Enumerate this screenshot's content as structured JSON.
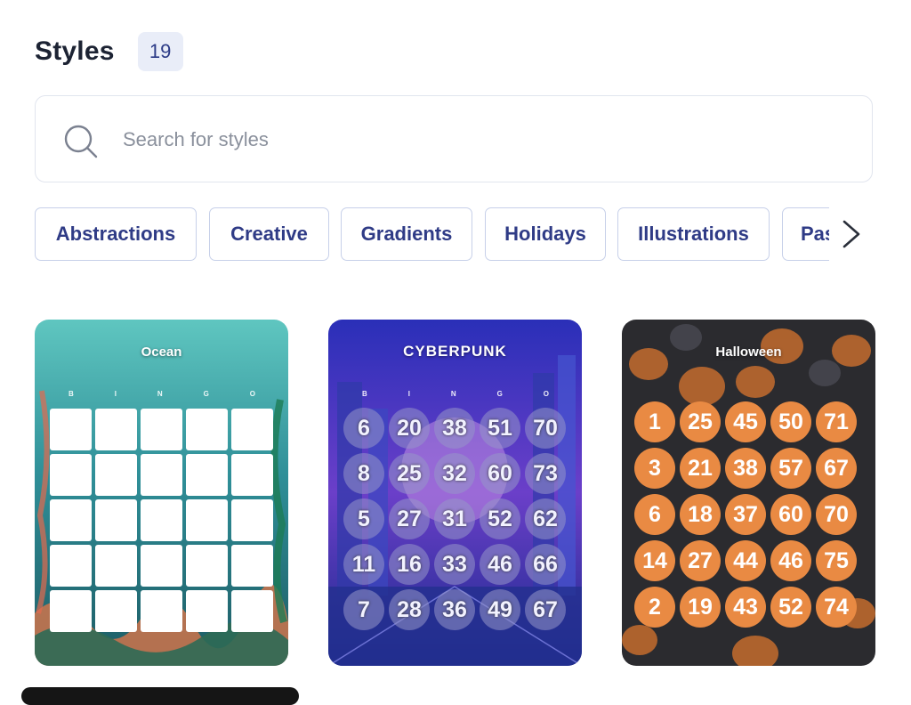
{
  "header": {
    "title": "Styles",
    "count": "19"
  },
  "search": {
    "placeholder": "Search for styles",
    "value": ""
  },
  "filters": [
    "Abstractions",
    "Creative",
    "Gradients",
    "Holidays",
    "Illustrations",
    "Pas"
  ],
  "cards": [
    {
      "title": "Ocean",
      "bingo": [
        "B",
        "I",
        "N",
        "G",
        "O"
      ]
    },
    {
      "title": "CYBERPUNK",
      "bingo": [
        "B",
        "I",
        "N",
        "G",
        "O"
      ],
      "numbers": [
        [
          6,
          20,
          38,
          51,
          70
        ],
        [
          8,
          25,
          32,
          60,
          73
        ],
        [
          5,
          27,
          31,
          52,
          62
        ],
        [
          11,
          16,
          33,
          46,
          66
        ],
        [
          7,
          28,
          36,
          49,
          67
        ]
      ]
    },
    {
      "title": "Halloween",
      "numbers": [
        [
          1,
          25,
          45,
          50,
          71
        ],
        [
          3,
          21,
          38,
          57,
          67
        ],
        [
          6,
          18,
          37,
          60,
          70
        ],
        [
          14,
          27,
          44,
          46,
          75
        ],
        [
          2,
          19,
          43,
          52,
          74
        ]
      ]
    }
  ],
  "icons": {
    "search": "search-icon",
    "next": "chevron-right-icon"
  },
  "colors": {
    "accent": "#2f3b86",
    "badge_bg": "#e9edf8",
    "halloween_ball": "#e98a43"
  }
}
